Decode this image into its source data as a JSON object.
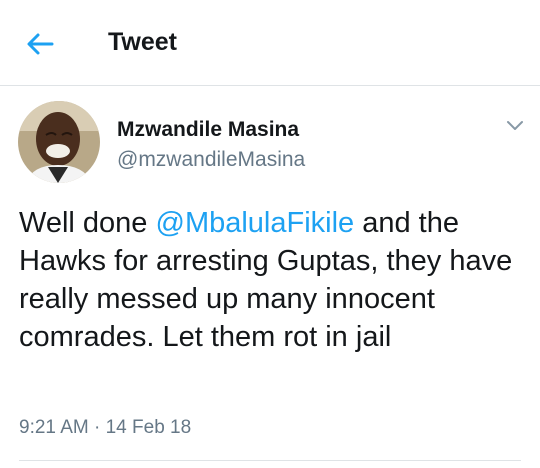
{
  "header": {
    "title": "Tweet",
    "back_icon": "back-arrow-icon"
  },
  "tweet": {
    "author_name": "Mzwandile Masina",
    "author_handle": "@mzwandileMasina",
    "text_before": "Well done ",
    "mention": "@MbalulaFikile",
    "text_after": " and the Hawks for arresting Guptas, they have really messed up many innocent comrades. Let them rot in jail",
    "time": "9:21 AM",
    "separator": "·",
    "date": "14 Feb 18",
    "menu_icon": "chevron-down-icon"
  },
  "colors": {
    "accent": "#1da1f2",
    "text": "#14171a",
    "secondary": "#657786",
    "divider": "#dfe3e6"
  }
}
